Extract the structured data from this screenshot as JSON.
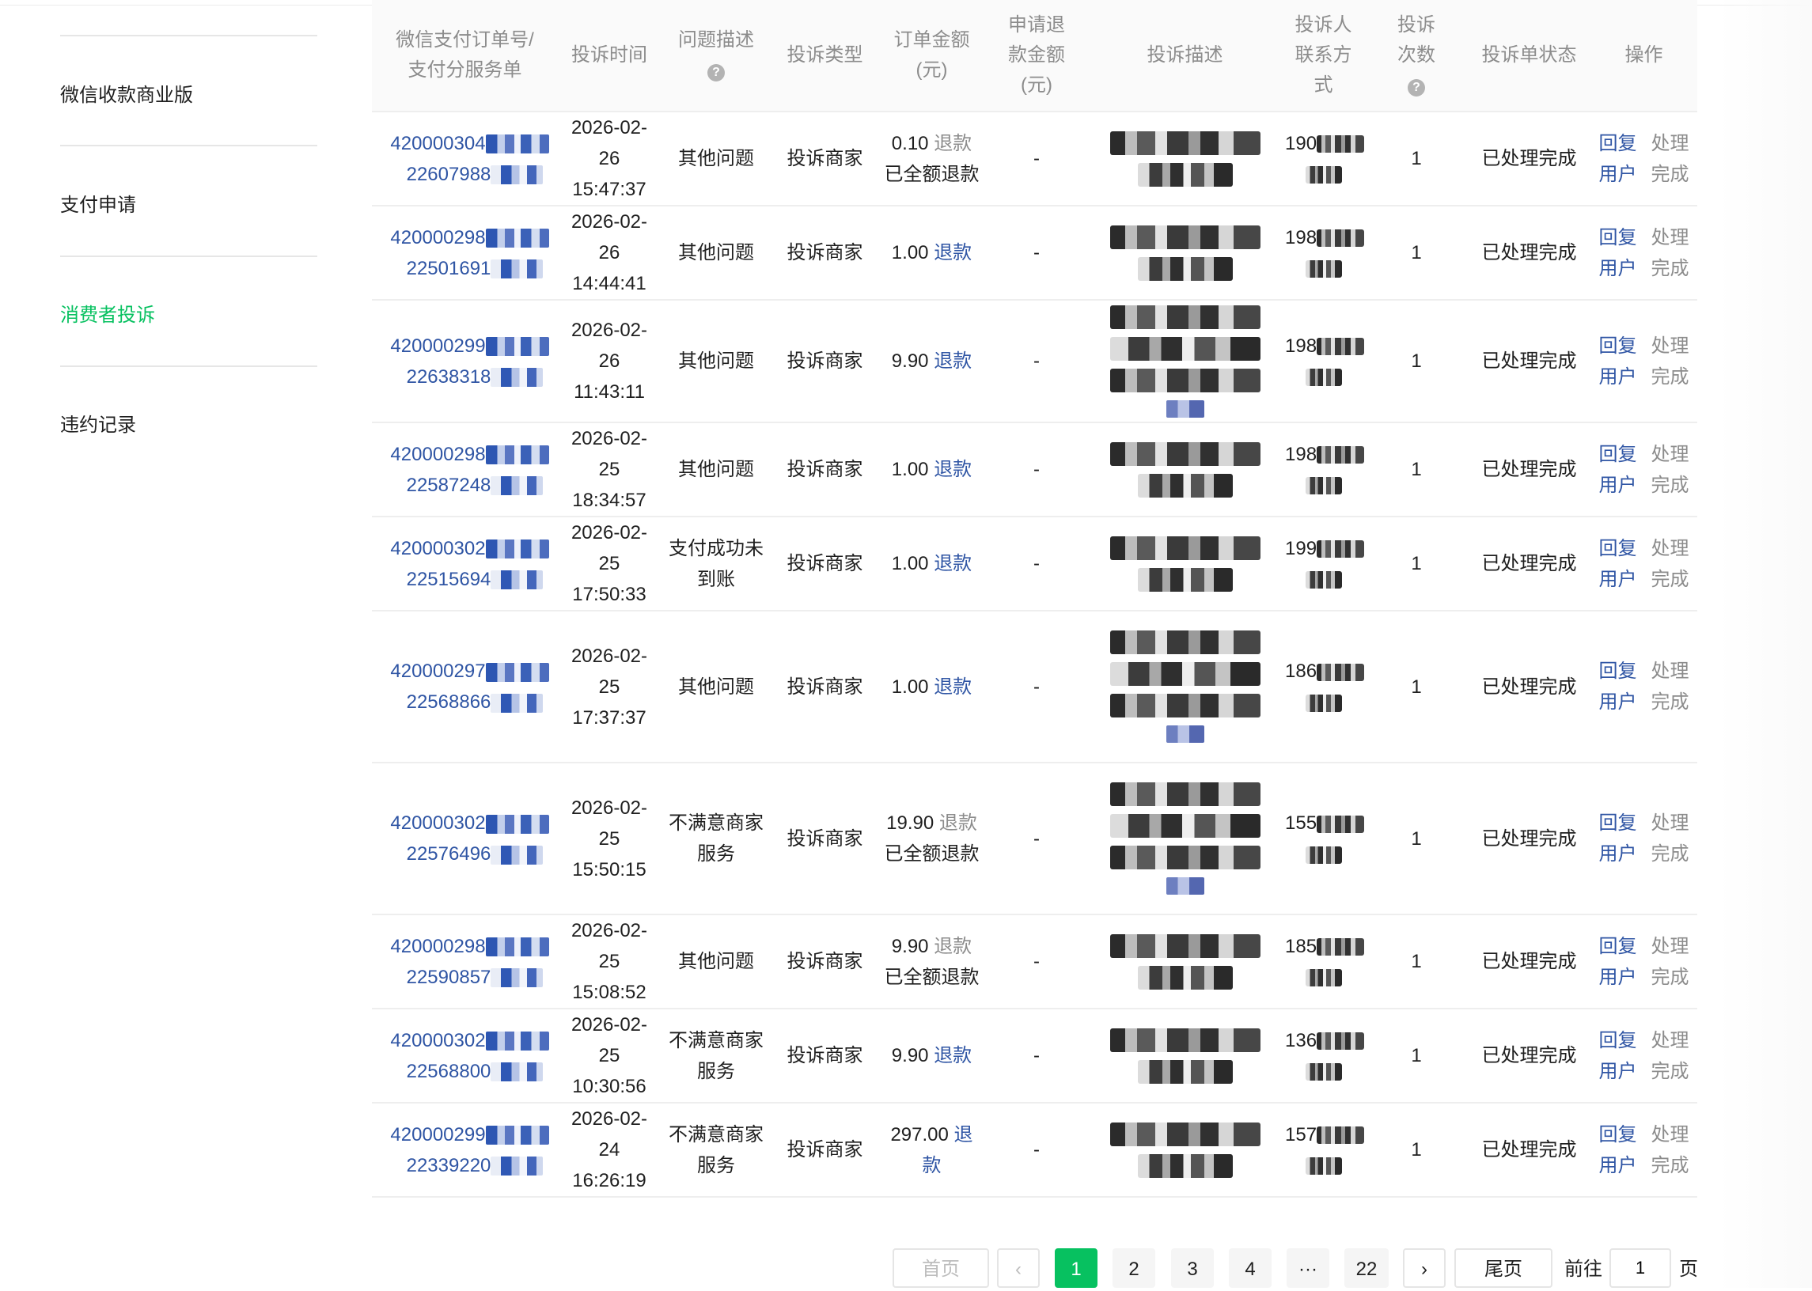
{
  "sidebar": {
    "items": [
      {
        "label": "微信收款商业版",
        "active": false
      },
      {
        "label": "支付申请",
        "active": false
      },
      {
        "label": "消费者投诉",
        "active": true
      },
      {
        "label": "违约记录",
        "active": false
      }
    ]
  },
  "table": {
    "headers": {
      "order": [
        "微信支付订单号/",
        "支付分服务单"
      ],
      "time": "投诉时间",
      "problem": "问题描述",
      "type": "投诉类型",
      "amount": [
        "订单金额",
        "(元)"
      ],
      "refund_req": [
        "申请退",
        "款金额",
        "(元)"
      ],
      "desc": "投诉描述",
      "contact": [
        "投诉人",
        "联系方",
        "式"
      ],
      "count": [
        "投诉",
        "次数"
      ],
      "status": "投诉单状态",
      "ops": "操作"
    },
    "rows": [
      {
        "order1": "420000304",
        "order2": "22607988",
        "date": "2026-02-26",
        "time": "15:47:37",
        "problem": [
          "其他问题"
        ],
        "type": "投诉商家",
        "amount": "0.10",
        "refund_link": "退款",
        "refund_note": "已全额退款",
        "refund_req": "-",
        "phone1": "190",
        "count": "1",
        "status": "已处理完成",
        "op_reply": [
          "回复",
          "用户"
        ],
        "op_done": [
          "处理",
          "完成"
        ]
      },
      {
        "order1": "420000298",
        "order2": "22501691",
        "date": "2026-02-26",
        "time": "14:44:41",
        "problem": [
          "其他问题"
        ],
        "type": "投诉商家",
        "amount": "1.00",
        "refund_link": "退款",
        "refund_note": "",
        "refund_req": "-",
        "phone1": "198",
        "count": "1",
        "status": "已处理完成",
        "op_reply": [
          "回复",
          "用户"
        ],
        "op_done": [
          "处理",
          "完成"
        ]
      },
      {
        "order1": "420000299",
        "order2": "22638318",
        "date": "2026-02-26",
        "time": "11:43:11",
        "problem": [
          "其他问题"
        ],
        "type": "投诉商家",
        "amount": "9.90",
        "refund_link": "退款",
        "refund_note": "",
        "refund_req": "-",
        "phone1": "198",
        "count": "1",
        "status": "已处理完成",
        "op_reply": [
          "回复",
          "用户"
        ],
        "op_done": [
          "处理",
          "完成"
        ]
      },
      {
        "order1": "420000298",
        "order2": "22587248",
        "date": "2026-02-25",
        "time": "18:34:57",
        "problem": [
          "其他问题"
        ],
        "type": "投诉商家",
        "amount": "1.00",
        "refund_link": "退款",
        "refund_note": "",
        "refund_req": "-",
        "phone1": "198",
        "count": "1",
        "status": "已处理完成",
        "op_reply": [
          "回复",
          "用户"
        ],
        "op_done": [
          "处理",
          "完成"
        ]
      },
      {
        "order1": "420000302",
        "order2": "22515694",
        "date": "2026-02-25",
        "time": "17:50:33",
        "problem": [
          "支付成功未",
          "到账"
        ],
        "type": "投诉商家",
        "amount": "1.00",
        "refund_link": "退款",
        "refund_note": "",
        "refund_req": "-",
        "phone1": "199",
        "count": "1",
        "status": "已处理完成",
        "op_reply": [
          "回复",
          "用户"
        ],
        "op_done": [
          "处理",
          "完成"
        ]
      },
      {
        "order1": "420000297",
        "order2": "22568866",
        "date": "2026-02-25",
        "time": "17:37:37",
        "problem": [
          "其他问题"
        ],
        "type": "投诉商家",
        "amount": "1.00",
        "refund_link": "退款",
        "refund_note": "",
        "refund_req": "-",
        "phone1": "186",
        "count": "1",
        "status": "已处理完成",
        "op_reply": [
          "回复",
          "用户"
        ],
        "op_done": [
          "处理",
          "完成"
        ]
      },
      {
        "order1": "420000302",
        "order2": "22576496",
        "date": "2026-02-25",
        "time": "15:50:15",
        "problem": [
          "不满意商家",
          "服务"
        ],
        "type": "投诉商家",
        "amount": "19.90",
        "refund_link": "退款",
        "refund_note": "已全额退款",
        "refund_req": "-",
        "phone1": "155",
        "count": "1",
        "status": "已处理完成",
        "op_reply": [
          "回复",
          "用户"
        ],
        "op_done": [
          "处理",
          "完成"
        ]
      },
      {
        "order1": "420000298",
        "order2": "22590857",
        "date": "2026-02-25",
        "time": "15:08:52",
        "problem": [
          "其他问题"
        ],
        "type": "投诉商家",
        "amount": "9.90",
        "refund_link": "退款",
        "refund_note": "已全额退款",
        "refund_req": "-",
        "phone1": "185",
        "count": "1",
        "status": "已处理完成",
        "op_reply": [
          "回复",
          "用户"
        ],
        "op_done": [
          "处理",
          "完成"
        ]
      },
      {
        "order1": "420000302",
        "order2": "22568800",
        "date": "2026-02-25",
        "time": "10:30:56",
        "problem": [
          "不满意商家",
          "服务"
        ],
        "type": "投诉商家",
        "amount": "9.90",
        "refund_link": "退款",
        "refund_note": "",
        "refund_req": "-",
        "phone1": "136",
        "count": "1",
        "status": "已处理完成",
        "op_reply": [
          "回复",
          "用户"
        ],
        "op_done": [
          "处理",
          "完成"
        ]
      },
      {
        "order1": "420000299",
        "order2": "22339220",
        "date": "2026-02-24",
        "time": "16:26:19",
        "problem": [
          "不满意商家",
          "服务"
        ],
        "type": "投诉商家",
        "amount": "297.00",
        "refund_link": "退款",
        "refund_note": "",
        "refund_req": "-",
        "phone1": "157",
        "count": "1",
        "status": "已处理完成",
        "op_reply": [
          "回复",
          "用户"
        ],
        "op_done": [
          "处理",
          "完成"
        ]
      }
    ]
  },
  "pagination": {
    "first": "首页",
    "prev": "‹",
    "pages": [
      "1",
      "2",
      "3",
      "4",
      "···",
      "22"
    ],
    "current": "1",
    "next": "›",
    "last": "尾页",
    "goto_label": "前往",
    "goto_value": "1",
    "goto_unit": "页"
  },
  "colors": {
    "accent": "#07c160",
    "link": "#2f55a4",
    "muted": "#8c8c8c"
  }
}
